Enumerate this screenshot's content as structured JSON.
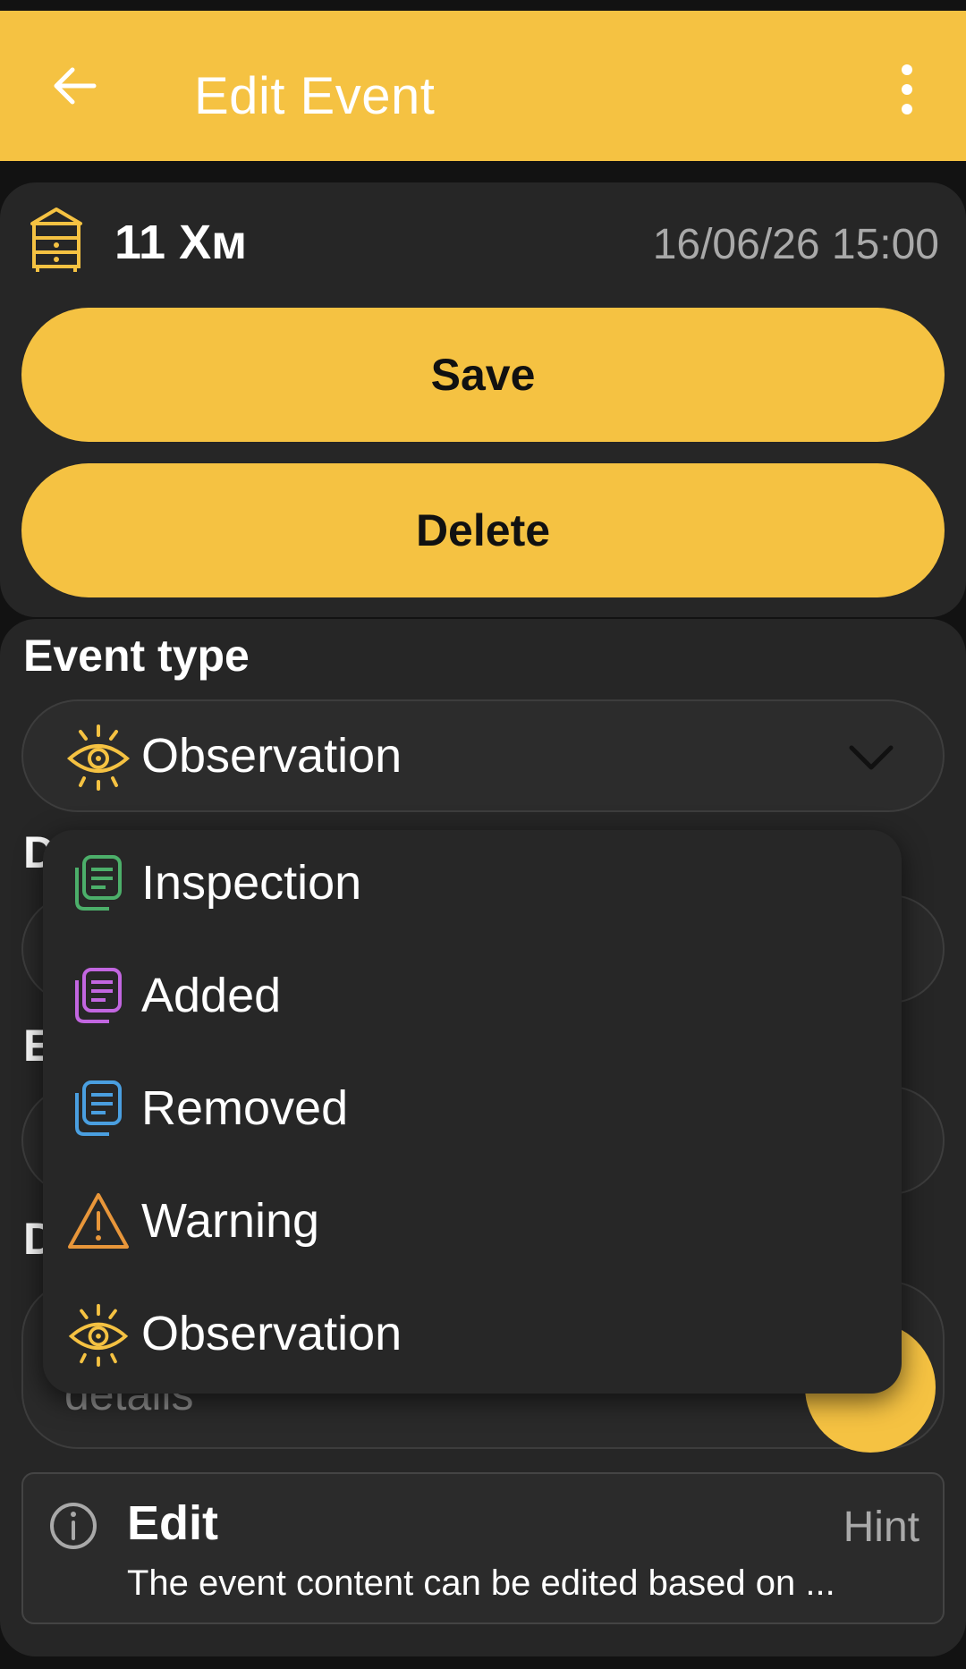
{
  "appbar": {
    "title": "Edit Event",
    "back_icon": "arrow-left-icon",
    "menu_icon": "more-vertical-icon"
  },
  "hive": {
    "name": "11 Хм",
    "datetime": "16/06/26 15:00",
    "icon": "beehive-icon"
  },
  "actions": {
    "save_label": "Save",
    "delete_label": "Delete"
  },
  "event_type": {
    "label": "Event type",
    "selected": "Observation",
    "selected_icon": "eye-icon",
    "options": [
      {
        "label": "Inspection",
        "icon": "document-icon",
        "color": "#4CAF6A"
      },
      {
        "label": "Added",
        "icon": "document-icon",
        "color": "#C266E0"
      },
      {
        "label": "Removed",
        "icon": "document-icon",
        "color": "#4A9FE0"
      },
      {
        "label": "Warning",
        "icon": "warning-icon",
        "color": "#E8963A"
      },
      {
        "label": "Observation",
        "icon": "eye-icon",
        "color": "#F5C242"
      }
    ]
  },
  "background": {
    "label_d1": "D",
    "label_e": "E",
    "label_d2": "D",
    "details_placeholder": "details"
  },
  "hint": {
    "title": "Edit",
    "tag": "Hint",
    "body": "The event content can be edited based on ..."
  },
  "colors": {
    "accent": "#F5C242",
    "surface": "#262626",
    "background": "#121212"
  }
}
